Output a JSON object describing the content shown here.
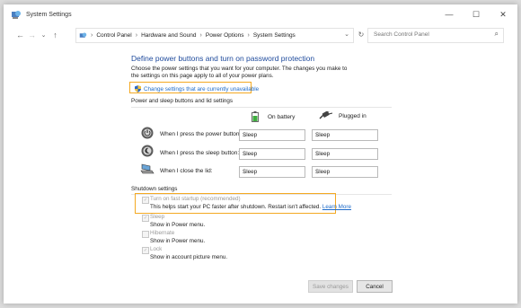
{
  "window": {
    "title": "System Settings",
    "minimize_glyph": "—",
    "maximize_glyph": "☐",
    "close_glyph": "✕"
  },
  "nav": {
    "back_glyph": "←",
    "forward_glyph": "→",
    "dropdown_glyph": "⌄",
    "up_glyph": "↑"
  },
  "address": {
    "segments": [
      "Control Panel",
      "Hardware and Sound",
      "Power Options",
      "System Settings"
    ],
    "separator": "›",
    "dropdown_glyph": "⌄",
    "refresh_glyph": "↻"
  },
  "search": {
    "placeholder": "Search Control Panel",
    "icon": "search-icon",
    "icon_glyph": "⌕"
  },
  "main": {
    "heading": "Define power buttons and turn on password protection",
    "description": "Choose the power settings that you want for your computer. The changes you make to the settings on this page apply to all of your power plans.",
    "change_link": "Change settings that are currently unavailable",
    "highlight_color": "#f4a922",
    "link_color": "#1e6bc9"
  },
  "power_section": {
    "title": "Power and sleep buttons and lid settings",
    "col_battery": "On battery",
    "col_plugged": "Plugged in",
    "chev_glyph": "⌄",
    "rows": [
      {
        "label": "When I press the power button:",
        "battery": "Sleep",
        "plugged": "Sleep",
        "icon": "power-button-icon"
      },
      {
        "label": "When I press the sleep button:",
        "battery": "Sleep",
        "plugged": "Sleep",
        "icon": "sleep-button-icon"
      },
      {
        "label": "When I close the lid:",
        "battery": "Sleep",
        "plugged": "Sleep",
        "icon": "laptop-lid-icon"
      }
    ]
  },
  "shutdown_section": {
    "title": "Shutdown settings",
    "check_glyph": "✓",
    "options": [
      {
        "label": "Turn on fast startup (recommended)",
        "desc": "This helps start your PC faster after shutdown. Restart isn't affected.",
        "link": "Learn More",
        "checked": true
      },
      {
        "label": "Sleep",
        "desc": "Show in Power menu.",
        "checked": true
      },
      {
        "label": "Hibernate",
        "desc": "Show in Power menu.",
        "checked": false
      },
      {
        "label": "Lock",
        "desc": "Show in account picture menu.",
        "checked": true
      }
    ]
  },
  "footer": {
    "save": "Save changes",
    "cancel": "Cancel"
  }
}
